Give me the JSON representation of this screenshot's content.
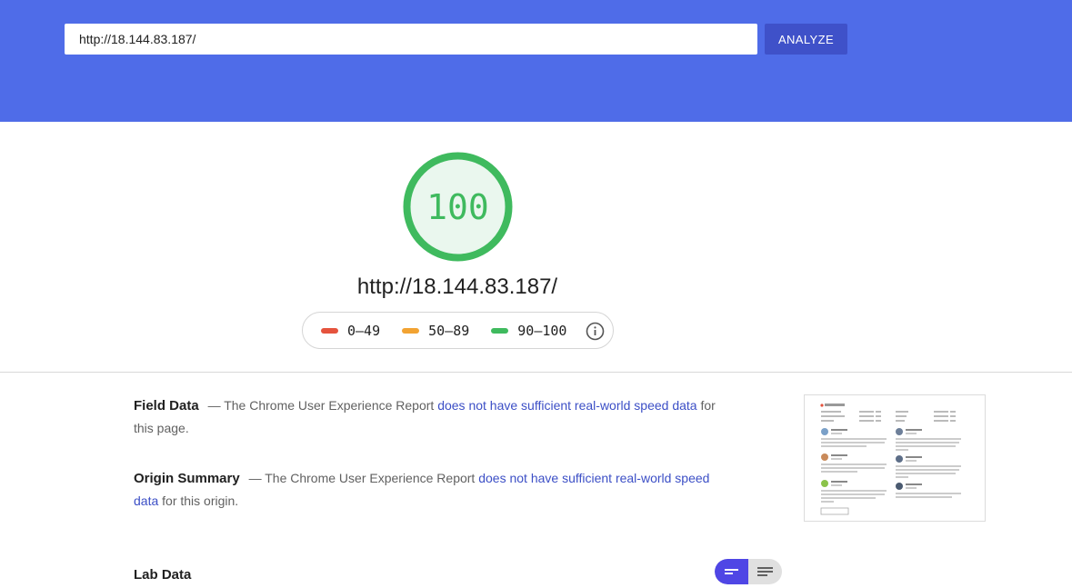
{
  "header": {
    "url_value": "http://18.144.83.187/",
    "analyze_label": "ANALYZE"
  },
  "score": {
    "value": "100",
    "fraction": 1.0,
    "color": "#3fba5e"
  },
  "page_url": "http://18.144.83.187/",
  "legend": [
    {
      "label": "0–49",
      "color": "#e5533d"
    },
    {
      "label": "50–89",
      "color": "#f2a332"
    },
    {
      "label": "90–100",
      "color": "#3fba5e"
    }
  ],
  "field_data": {
    "title": "Field Data",
    "prefix": "— The Chrome User Experience Report ",
    "link": "does not have sufficient real-world speed data",
    "suffix": " for this page."
  },
  "origin_summary": {
    "title": "Origin Summary",
    "prefix": "— The Chrome User Experience Report ",
    "link": "does not have sufficient real-world speed data",
    "suffix": " for this origin."
  },
  "lab_data": {
    "title": "Lab Data"
  },
  "colors": {
    "header_bg": "#4f6ce8",
    "accent": "#3f51c9",
    "link": "#3c4fc6"
  }
}
